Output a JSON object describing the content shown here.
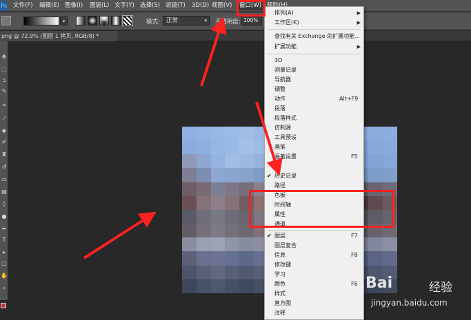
{
  "menubar": {
    "logo": "Ps",
    "items": [
      "文件(F)",
      "编辑(E)",
      "图像(I)",
      "图层(L)",
      "文字(Y)",
      "选择(S)",
      "滤镜(T)",
      "3D(D)",
      "视图(V)",
      "窗口(W)",
      "帮助(H)"
    ]
  },
  "options": {
    "mode_label": "模式:",
    "mode_value": "正常",
    "opacity_label": "不透明度:",
    "opacity_value": "100%"
  },
  "tab": {
    "title": "png @ 72.9% (图层 1 拷贝, RGB/8) *"
  },
  "window_menu": {
    "items": [
      {
        "label": "排列(A)",
        "submenu": true
      },
      {
        "label": "工作区(K)",
        "submenu": true
      },
      {
        "label": "查找有关 Exchange 的扩展功能..."
      },
      {
        "label": "扩展功能",
        "submenu": true
      },
      {
        "label": "3D"
      },
      {
        "label": "测量记录"
      },
      {
        "label": "导航器"
      },
      {
        "label": "调整"
      },
      {
        "label": "动作",
        "shortcut": "Alt+F9"
      },
      {
        "label": "段落"
      },
      {
        "label": "段落样式"
      },
      {
        "label": "仿制源"
      },
      {
        "label": "工具预设"
      },
      {
        "label": "画笔"
      },
      {
        "label": "画笔设置",
        "shortcut": "F5"
      },
      {
        "label": "库"
      },
      {
        "label": "历史记录",
        "checked": true
      },
      {
        "label": "路径"
      },
      {
        "label": "色板"
      },
      {
        "label": "时间轴"
      },
      {
        "label": "属性"
      },
      {
        "label": "通道"
      },
      {
        "label": "图层",
        "checked": true,
        "shortcut": "F7"
      },
      {
        "label": "图层复合"
      },
      {
        "label": "信息",
        "shortcut": "F8"
      },
      {
        "label": "修改键"
      },
      {
        "label": "学习"
      },
      {
        "label": "颜色",
        "shortcut": "F6"
      },
      {
        "label": "样式"
      },
      {
        "label": "直方图"
      },
      {
        "label": "注释"
      }
    ]
  },
  "watermark": {
    "brand": "Bai",
    "sub": "经验",
    "url": "jingyan.baidu.com"
  },
  "colors": {
    "accent": "#ff2020",
    "menu_bg": "#f0f0f0",
    "app_bg": "#282828"
  }
}
